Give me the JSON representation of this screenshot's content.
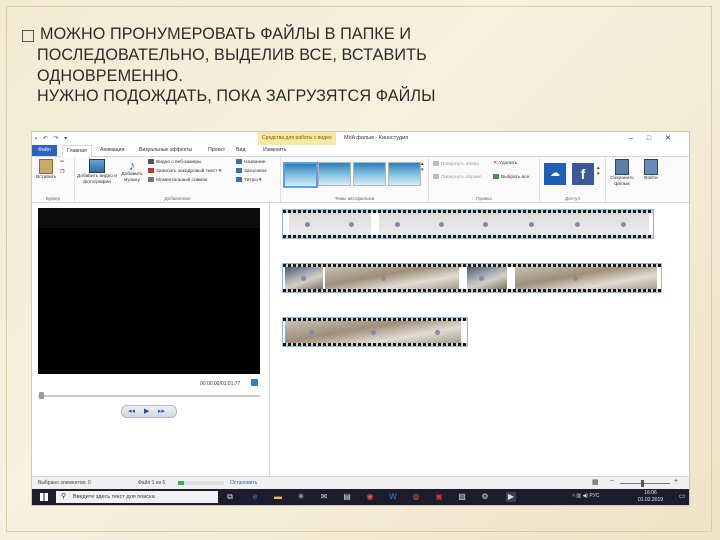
{
  "slide": {
    "heading_lines": [
      "МОЖНО ПРОНУМЕРОВАТЬ ФАЙЛЫ В ПАПКЕ И",
      "ПОСЛЕДОВАТЕЛЬНО, ВЫДЕЛИВ ВСЕ, ВСТАВИТЬ",
      "ОДНОВРЕМЕННО.",
      "НУЖНО ПОДОЖДАТЬ, ПОКА ЗАГРУЗЯТСЯ ФАЙЛЫ"
    ],
    "background": "#f7efd9"
  },
  "window": {
    "context_tab": "Средства для работы с видео",
    "title": "Мой фильм - Киностудия",
    "controls": [
      "–",
      "□",
      "✕"
    ]
  },
  "tabs": {
    "file": "Файл",
    "items": [
      "Главная",
      "Анимация",
      "Визуальные эффекты",
      "Проект",
      "Вид",
      "Изменить"
    ]
  },
  "ribbon": {
    "clipboard": {
      "paste": "Вставить",
      "group": "Буфер"
    },
    "add": {
      "add_video": "Добавить видео и фотографии",
      "add_music": "Добавить музыку",
      "webcam": "Видео с веб-камеры",
      "narration": "Записать закадровый текст",
      "snapshot": "Моментальный снимок",
      "caption": "Название",
      "title": "Заголовок",
      "credits": "Титры",
      "group": "Добавление"
    },
    "themes": {
      "group": "Темы автофильма"
    },
    "edit": {
      "rotate_left": "Повернуть влево",
      "rotate_right": "Повернуть вправо",
      "remove": "Удалить",
      "select_all": "Выбрать все",
      "group": "Правка"
    },
    "share": {
      "group": "Доступ"
    },
    "save": {
      "save_movie": "Сохранить фильм",
      "sign_in": "Войти"
    }
  },
  "preview": {
    "time": "00:00,00/01:01,77"
  },
  "status": {
    "selected": "Выбрано элементов: 0",
    "file_progress": "Файл 1 из 6",
    "stop": "Остановить",
    "progress_fraction": 0.12
  },
  "taskbar": {
    "search_placeholder": "Введите здесь текст для поиска",
    "language": "РУС",
    "time": "16:06",
    "date": "01.02.2019"
  },
  "colors": {
    "file_tab": "#2b62c2",
    "accent_selection": "#5aa0e8",
    "taskbar": "#1c1c2c",
    "progress": "#3fae49"
  }
}
